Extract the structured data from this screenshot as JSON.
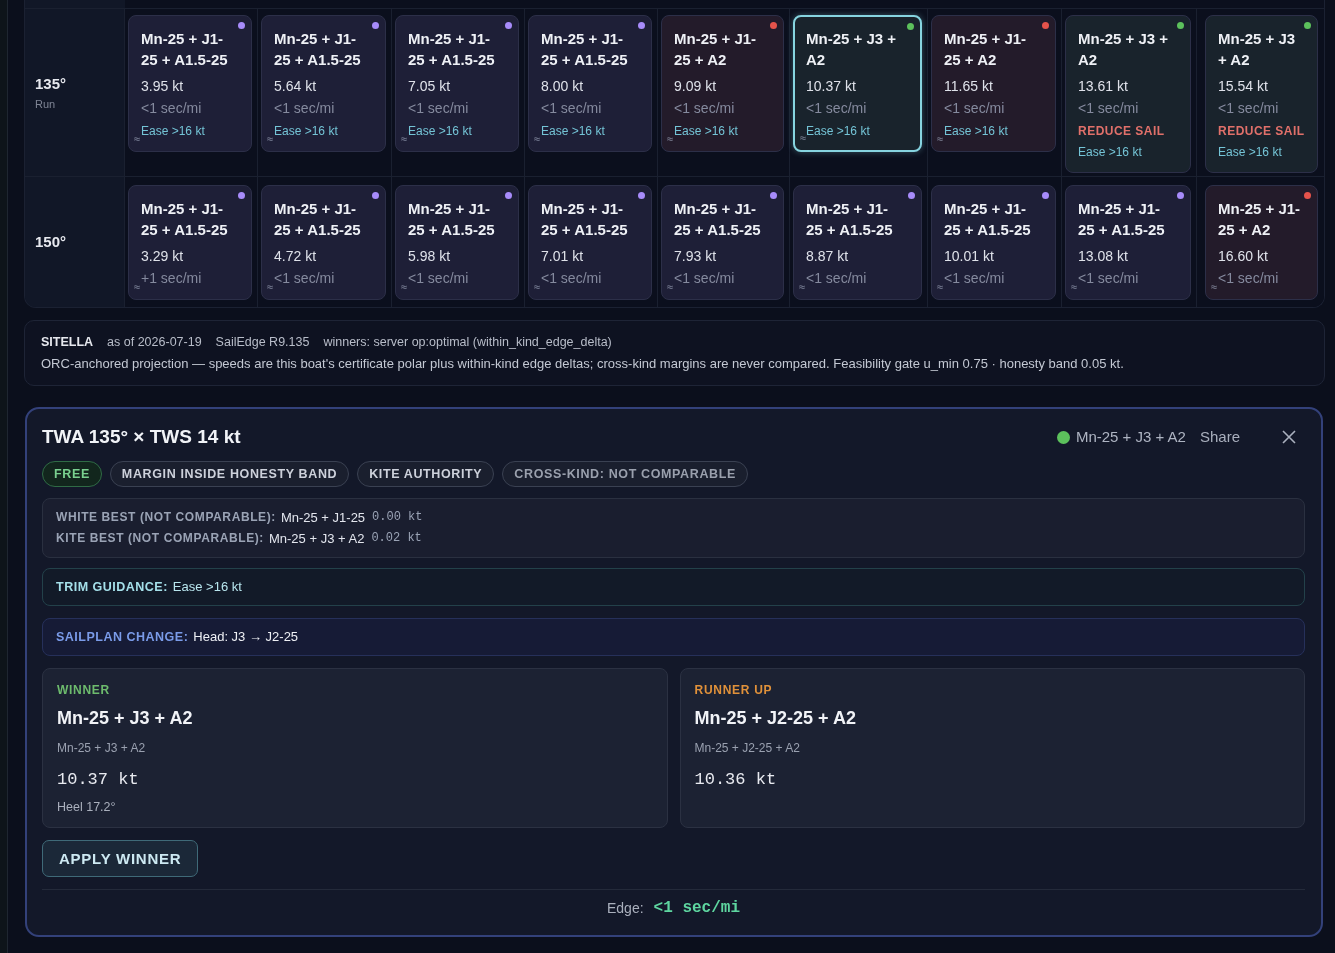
{
  "grid": {
    "rows": [
      {
        "angle": "135°",
        "point_of_sail": "Run",
        "cards": [
          {
            "plan": "Mn-25 + J1-25 + A1.5-25",
            "speed": "3.95 kt",
            "delta": "<1 sec/mi",
            "trim": "Ease >16 kt",
            "approx": true,
            "color": "#a78bfa",
            "selected": false
          },
          {
            "plan": "Mn-25 + J1-25 + A1.5-25",
            "speed": "5.64 kt",
            "delta": "<1 sec/mi",
            "trim": "Ease >16 kt",
            "approx": true,
            "color": "#a78bfa",
            "selected": false
          },
          {
            "plan": "Mn-25 + J1-25 + A1.5-25",
            "speed": "7.05 kt",
            "delta": "<1 sec/mi",
            "trim": "Ease >16 kt",
            "approx": true,
            "color": "#a78bfa",
            "selected": false
          },
          {
            "plan": "Mn-25 + J1-25 + A1.5-25",
            "speed": "8.00 kt",
            "delta": "<1 sec/mi",
            "trim": "Ease >16 kt",
            "approx": true,
            "color": "#a78bfa",
            "selected": false
          },
          {
            "plan": "Mn-25 + J1-25 + A2",
            "speed": "9.09 kt",
            "delta": "<1 sec/mi",
            "trim": "Ease >16 kt",
            "approx": true,
            "color": "#e5534b",
            "selected": false
          },
          {
            "plan": "Mn-25 + J3 + A2",
            "speed": "10.37 kt",
            "delta": "<1 sec/mi",
            "trim": "Ease >16 kt",
            "approx": true,
            "color": "#5cc15c",
            "selected": true
          },
          {
            "plan": "Mn-25 + J1-25 + A2",
            "speed": "11.65 kt",
            "delta": "<1 sec/mi",
            "trim": "Ease >16 kt",
            "approx": true,
            "color": "#e5534b",
            "selected": false
          },
          {
            "plan": "Mn-25 + J3 + A2",
            "speed": "13.61 kt",
            "delta": "<1 sec/mi",
            "warning": "REDUCE SAIL",
            "trim": "Ease >16 kt",
            "approx": false,
            "color": "#5cc15c",
            "selected": false
          },
          {
            "plan": "Mn-25 + J3 + A2",
            "speed": "15.54 kt",
            "delta": "<1 sec/mi",
            "warning": "REDUCE SAIL",
            "trim": "Ease >16 kt",
            "approx": false,
            "color": "#5cc15c",
            "selected": false
          }
        ]
      },
      {
        "angle": "150°",
        "cards": [
          {
            "plan": "Mn-25 + J1-25 + A1.5-25",
            "speed": "3.29 kt",
            "delta": "+1 sec/mi",
            "approx": true,
            "color": "#a78bfa",
            "selected": false
          },
          {
            "plan": "Mn-25 + J1-25 + A1.5-25",
            "speed": "4.72 kt",
            "delta": "<1 sec/mi",
            "approx": true,
            "color": "#a78bfa",
            "selected": false
          },
          {
            "plan": "Mn-25 + J1-25 + A1.5-25",
            "speed": "5.98 kt",
            "delta": "<1 sec/mi",
            "approx": true,
            "color": "#a78bfa",
            "selected": false
          },
          {
            "plan": "Mn-25 + J1-25 + A1.5-25",
            "speed": "7.01 kt",
            "delta": "<1 sec/mi",
            "approx": true,
            "color": "#a78bfa",
            "selected": false
          },
          {
            "plan": "Mn-25 + J1-25 + A1.5-25",
            "speed": "7.93 kt",
            "delta": "<1 sec/mi",
            "approx": true,
            "color": "#a78bfa",
            "selected": false
          },
          {
            "plan": "Mn-25 + J1-25 + A1.5-25",
            "speed": "8.87 kt",
            "delta": "<1 sec/mi",
            "approx": true,
            "color": "#a78bfa",
            "selected": false
          },
          {
            "plan": "Mn-25 + J1-25 + A1.5-25",
            "speed": "10.01 kt",
            "delta": "<1 sec/mi",
            "approx": true,
            "color": "#a78bfa",
            "selected": false
          },
          {
            "plan": "Mn-25 + J1-25 + A1.5-25",
            "speed": "13.08 kt",
            "delta": "<1 sec/mi",
            "approx": true,
            "color": "#a78bfa",
            "selected": false
          },
          {
            "plan": "Mn-25 + J1-25 + A2",
            "speed": "16.60 kt",
            "delta": "<1 sec/mi",
            "approx": true,
            "color": "#e5534b",
            "selected": false
          }
        ]
      }
    ]
  },
  "info": {
    "boat": "SITELLA",
    "date": "as of 2026-07-19",
    "version": "SailEdge R9.135",
    "winners": "winners: server op:optimal (within_kind_edge_delta)",
    "note": "ORC-anchored projection — speeds are this boat's certificate polar plus within-kind edge deltas; cross-kind margins are never compared. Feasibility gate u_min 0.75 · honesty band 0.05 kt."
  },
  "detail": {
    "title": "TWA 135° × TWS 14 kt",
    "winner_badge": {
      "label": "Mn-25 + J3 + A2",
      "color": "#5cc15c"
    },
    "share": "Share",
    "chips": [
      {
        "label": "FREE",
        "kind": "free"
      },
      {
        "label": "MARGIN INSIDE HONESTY BAND",
        "kind": "neutral"
      },
      {
        "label": "KITE AUTHORITY",
        "kind": "neutral"
      },
      {
        "label": "CROSS-KIND: NOT COMPARABLE",
        "kind": "muted"
      }
    ],
    "comparison": [
      {
        "label": "WHITE BEST (NOT COMPARABLE):",
        "plan": "Mn-25 + J1-25",
        "margin": "0.00 kt"
      },
      {
        "label": "KITE BEST (NOT COMPARABLE):",
        "plan": "Mn-25 + J3 + A2",
        "margin": "0.02 kt"
      }
    ],
    "notices": [
      {
        "kind": "trim",
        "label": "TRIM GUIDANCE:",
        "value": "Ease >16 kt"
      },
      {
        "kind": "sailplan",
        "label": "SAILPLAN CHANGE:",
        "value": "Head: J3 → J2-25"
      }
    ],
    "candidates": [
      {
        "kind": "winner",
        "role": "WINNER",
        "name": "Mn-25 + J3 + A2",
        "sub": "Mn-25 + J3 + A2",
        "speed": "10.37 kt",
        "heel": "Heel 17.2°"
      },
      {
        "kind": "runner_up",
        "role": "RUNNER UP",
        "name": "Mn-25 + J2-25 + A2",
        "sub": "Mn-25 + J2-25 + A2",
        "speed": "10.36 kt"
      }
    ],
    "apply_button": "APPLY WINNER",
    "edge": {
      "label": "Edge:",
      "value": "<1 sec/mi"
    }
  }
}
